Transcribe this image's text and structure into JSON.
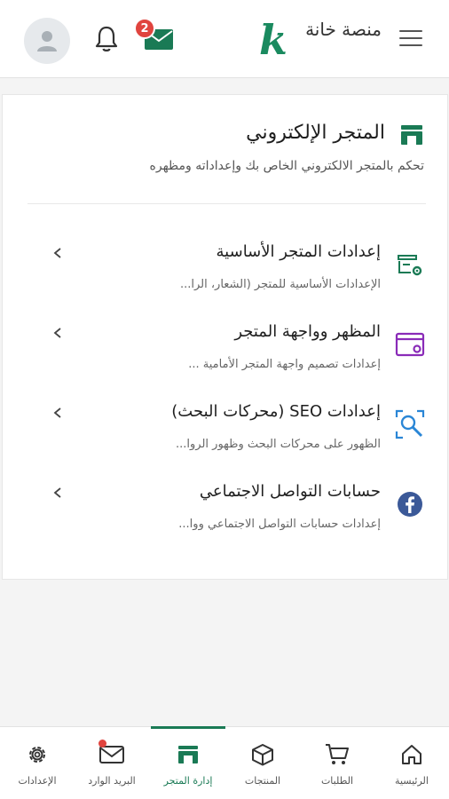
{
  "header": {
    "logo_letter": "k",
    "logo_text": "منصة خانة",
    "notification_count": "2"
  },
  "store_card": {
    "title": "المتجر الإلكتروني",
    "subtitle": "تحكم بالمتجر الالكتروني الخاص بك وإعداداته ومظهره",
    "items": [
      {
        "title": "إعدادات المتجر الأساسية",
        "description": "الإعدادات الأساسية للمتجر (الشعار، الرا...",
        "icon": "store-settings-icon"
      },
      {
        "title": "المظهر وواجهة المتجر",
        "description": "إعدادات تصميم واجهة المتجر الأمامية ...",
        "icon": "window-settings-icon"
      },
      {
        "title": "إعدادات SEO (محركات البحث)",
        "description": "الظهور على محركات البحث وظهور الروا...",
        "icon": "seo-search-icon"
      },
      {
        "title": "حسابات التواصل الاجتماعي",
        "description": "إعدادات حسابات التواصل الاجتماعي ووا...",
        "icon": "facebook-icon"
      }
    ]
  },
  "bottom_nav": {
    "items": [
      {
        "label": "الإعدادات",
        "icon": "gear-icon"
      },
      {
        "label": "البريد الوارد",
        "icon": "mail-icon"
      },
      {
        "label": "إدارة المتجر",
        "icon": "store-icon",
        "active": true
      },
      {
        "label": "المنتجات",
        "icon": "box-icon"
      },
      {
        "label": "الطلبات",
        "icon": "cart-icon"
      },
      {
        "label": "الرئيسية",
        "icon": "home-icon"
      }
    ]
  },
  "colors": {
    "brand_green": "#1a7a55",
    "badge_red": "#e0443e",
    "purple_icon": "#8a2bb8",
    "blue_icon": "#2a86d6",
    "facebook_blue": "#3b5998"
  }
}
